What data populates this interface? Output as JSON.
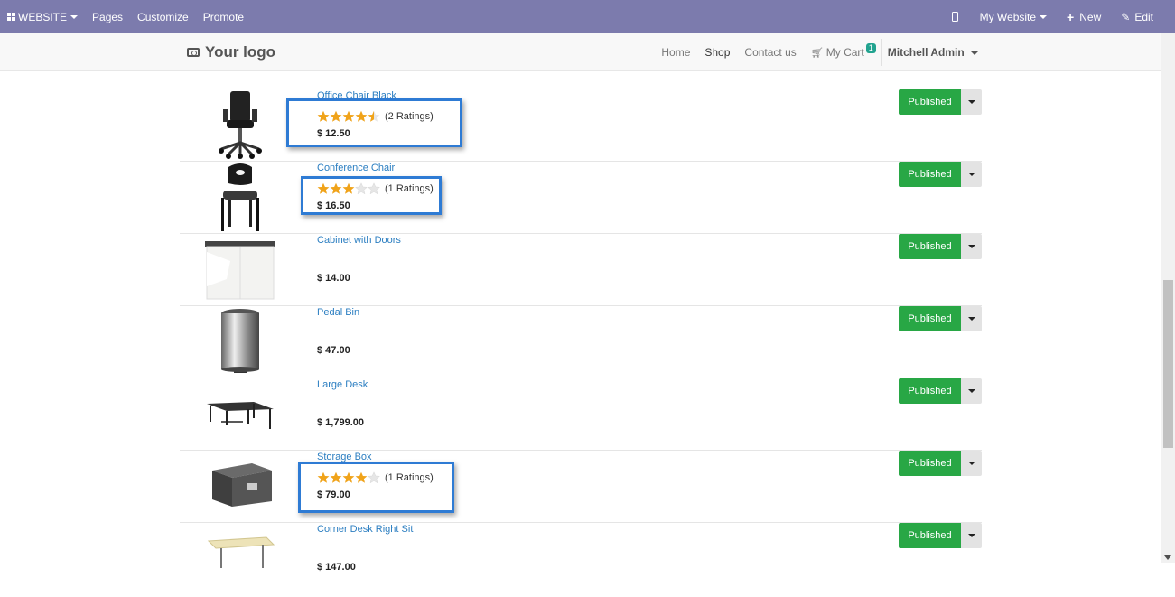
{
  "topbar": {
    "website_label": "WEBSITE",
    "pages_label": "Pages",
    "customize_label": "Customize",
    "promote_label": "Promote",
    "my_website_label": "My Website",
    "new_label": "New",
    "edit_label": "Edit"
  },
  "navbar": {
    "logo_text": "Your logo",
    "links": {
      "home": "Home",
      "shop": "Shop",
      "contact": "Contact us"
    },
    "cart_label": "My Cart",
    "cart_count": "1",
    "user_name": "Mitchell Admin"
  },
  "products": [
    {
      "name": "Office Chair Black",
      "rating": 4.5,
      "rating_text": "(2 Ratings)",
      "price": "$ 12.50",
      "status": "Published",
      "image": "office-chair"
    },
    {
      "name": "Conference Chair",
      "rating": 3,
      "rating_text": "(1 Ratings)",
      "price": "$ 16.50",
      "status": "Published",
      "image": "conference-chair"
    },
    {
      "name": "Cabinet with Doors",
      "price": "$ 14.00",
      "status": "Published",
      "image": "cabinet"
    },
    {
      "name": "Pedal Bin",
      "price": "$ 47.00",
      "status": "Published",
      "image": "pedal-bin"
    },
    {
      "name": "Large Desk",
      "price": "$ 1,799.00",
      "status": "Published",
      "image": "large-desk"
    },
    {
      "name": "Storage Box",
      "rating": 4,
      "rating_text": "(1 Ratings)",
      "price": "$ 79.00",
      "status": "Published",
      "image": "storage-box"
    },
    {
      "name": "Corner Desk Right Sit",
      "price": "$ 147.00",
      "status": "Published",
      "image": "corner-desk"
    }
  ],
  "colors": {
    "topbar": "#7c7bad",
    "link": "#2b7ec1",
    "published": "#28a745",
    "star": "#f0a31a",
    "highlight": "#2e7bd4"
  }
}
